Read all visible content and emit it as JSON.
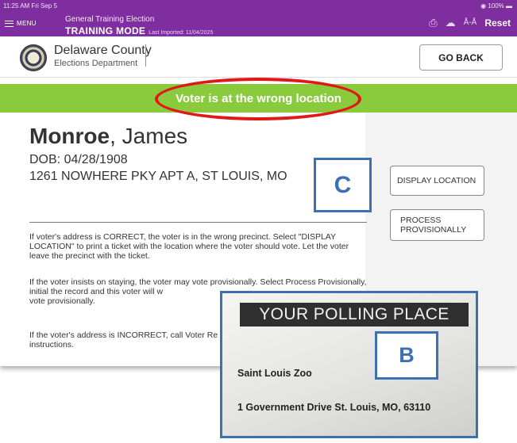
{
  "status_bar": {
    "time": "11:25 AM  Fri Sep 5",
    "battery": "◉ 100% ▬"
  },
  "top_bar": {
    "menu_label": "MENU",
    "election_name": "General Training Election",
    "mode_title": "TRAINING MODE",
    "last_imported": "Last Imported: 11/04/2025",
    "reset_label": "Reset",
    "icons": [
      "printer-icon",
      "cloud-icon",
      "users-icon"
    ]
  },
  "header": {
    "county_name": "Delaware County",
    "department": "Elections Department",
    "go_back_label": "GO BACK"
  },
  "alert": {
    "text": "Voter is at the wrong location",
    "color": "#8acb3e",
    "highlight_color": "#e01818"
  },
  "voter": {
    "last_name": "Monroe",
    "first_name": ", James",
    "dob": "DOB: 04/28/1908",
    "address": "1261 NOWHERE PKY APT A, ST LOUIS, MO"
  },
  "instructions": [
    "If voter's address is CORRECT, the voter is in the wrong precinct. Select \"DISPLAY LOCATION\" to print a ticket with the location where the voter should vote. Let the voter leave the precinct with the ticket.",
    "If the voter insists on staying, the voter may vote provisionally. Select Process Provisionally, initial the record and this voter will w",
    "If the voter's address is INCORRECT, call Voter Re"
  ],
  "instructions_tail": {
    "para2_line3": "vote provisionally.",
    "para3_line2": "instructions."
  },
  "actions": {
    "display_location": "DISPLAY LOCATION",
    "process_provisionally_line1": "PROCESS",
    "process_provisionally_line2": "PROVISIONALLY"
  },
  "callouts": {
    "c": "C",
    "b": "B",
    "color": "#3d6fb3"
  },
  "ticket": {
    "header": "YOUR POLLING PLACE",
    "place_name": "Saint Louis Zoo",
    "address": "1 Government Drive St. Louis, MO, 63110"
  },
  "colors": {
    "top_bar": "#7e2e9e"
  }
}
